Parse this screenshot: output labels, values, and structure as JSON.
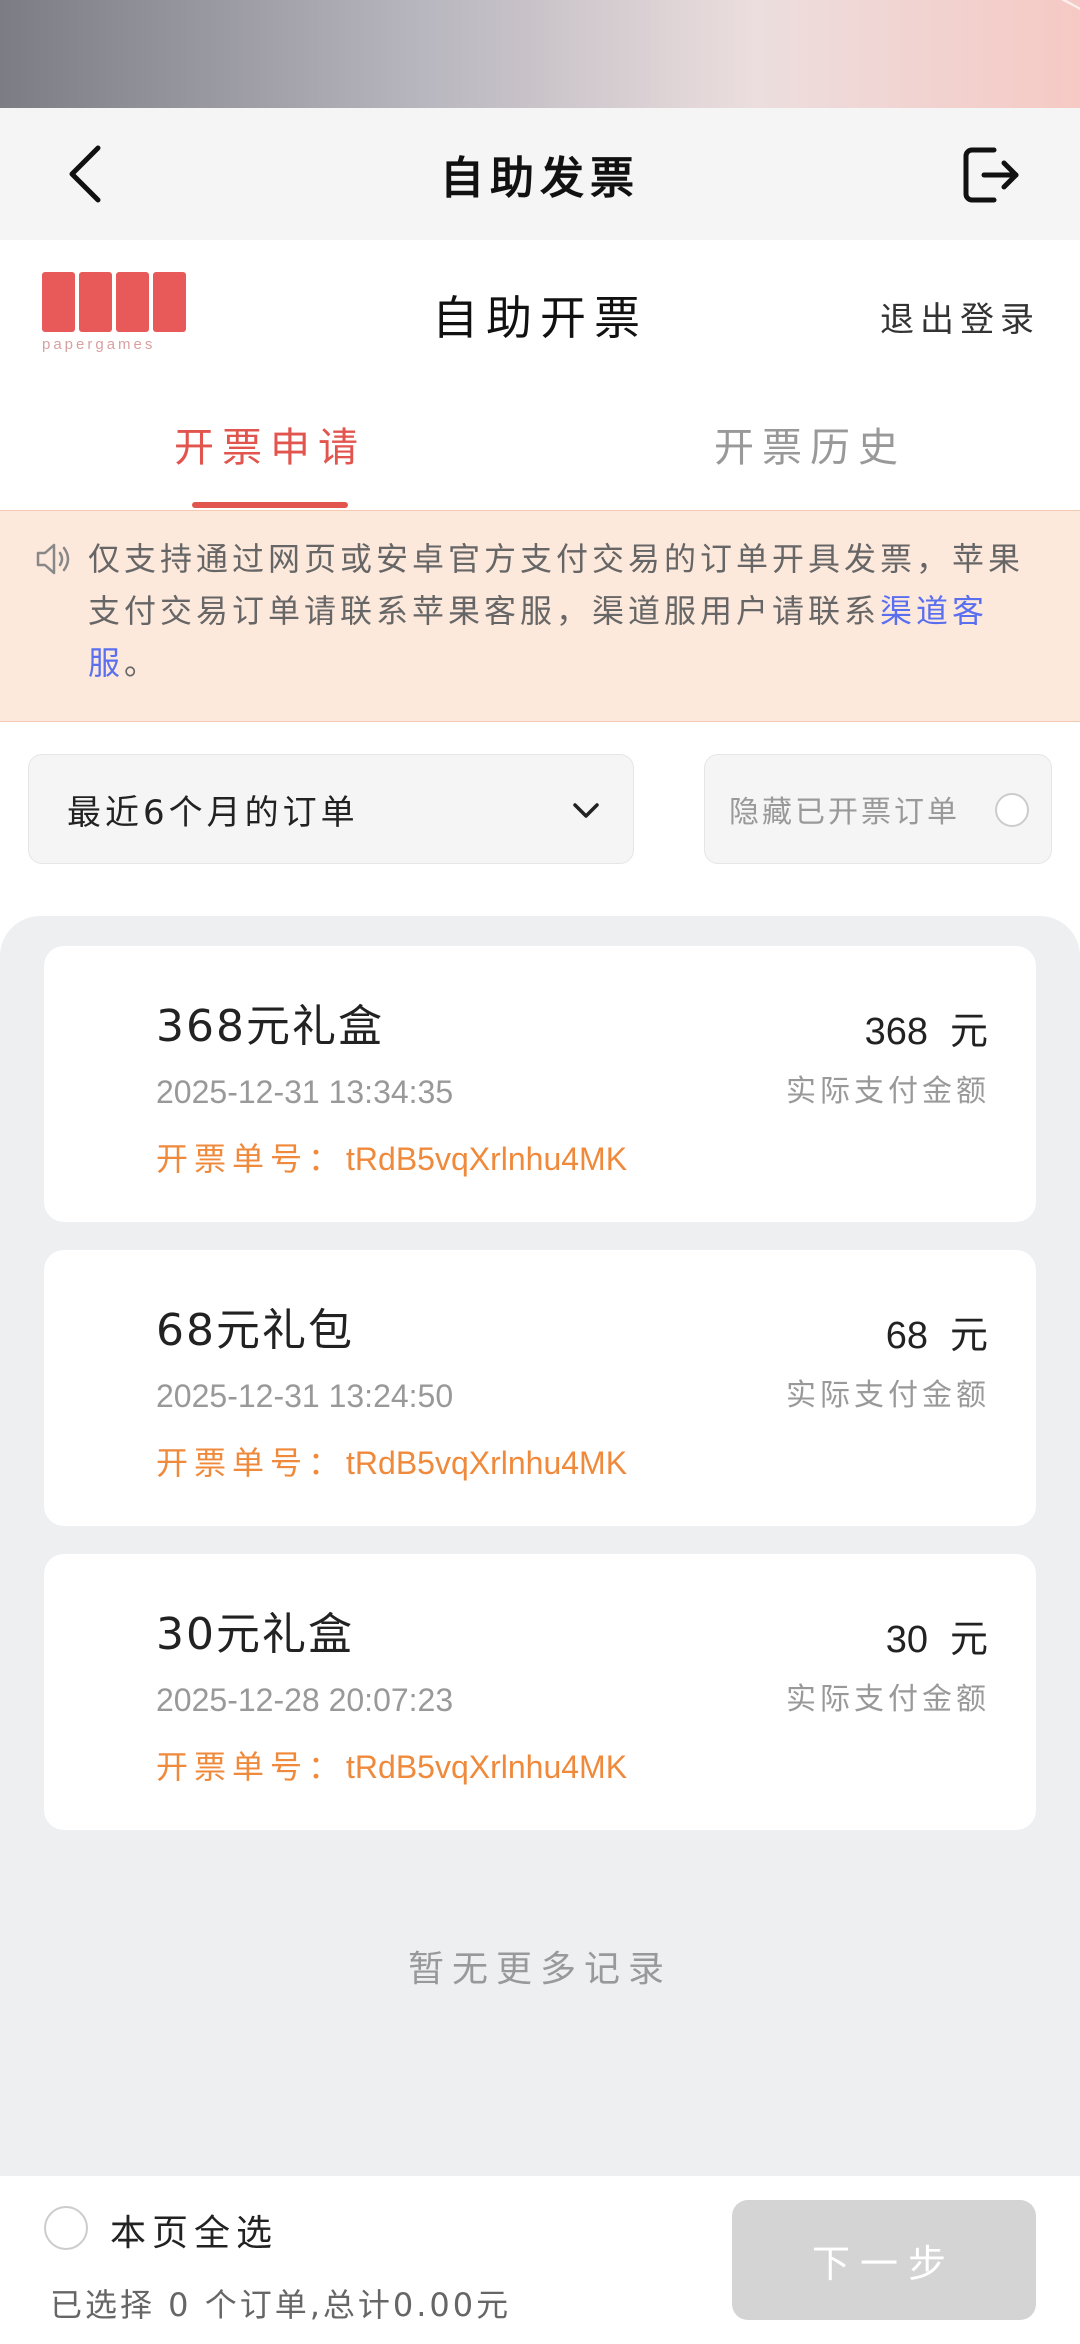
{
  "nav": {
    "title": "自助发票"
  },
  "header": {
    "brand_word": "papergames",
    "title": "自助开票",
    "logout": "退出登录"
  },
  "tabs": [
    {
      "label": "开票申请",
      "active": true
    },
    {
      "label": "开票历史",
      "active": false
    }
  ],
  "notice": {
    "text": "仅支持通过网页或安卓官方支付交易的订单开具发票，苹果支付交易订单请联系苹果客服，渠道服用户请联系",
    "link": "渠道客服",
    "tail": "。"
  },
  "filters": {
    "period": "最近6个月的订单",
    "hide_invoiced": "隐藏已开票订单"
  },
  "orders": [
    {
      "name": "368元礼盒",
      "date": "2025-12-31 13:34:35",
      "invoice_label": "开票单号：",
      "invoice_no": "tRdB5vqXrlnhu4MK",
      "amount": "368",
      "unit": "元",
      "paid_label": "实际支付金额"
    },
    {
      "name": "68元礼包",
      "date": "2025-12-31 13:24:50",
      "invoice_label": "开票单号：",
      "invoice_no": "tRdB5vqXrlnhu4MK",
      "amount": "68",
      "unit": "元",
      "paid_label": "实际支付金额"
    },
    {
      "name": "30元礼盒",
      "date": "2025-12-28 20:07:23",
      "invoice_label": "开票单号：",
      "invoice_no": "tRdB5vqXrlnhu4MK",
      "amount": "30",
      "unit": "元",
      "paid_label": "实际支付金额"
    }
  ],
  "no_more": "暂无更多记录",
  "footer": {
    "select_all": "本页全选",
    "summary": "已选择 0 个订单,总计0.00元",
    "next": "下一步"
  },
  "colors": {
    "accent": "#e2544e",
    "link": "#5a6ff0",
    "invoice_no": "#ef8a3c",
    "notice_bg": "#fde9dc"
  },
  "icons": [
    "back-arrow-icon",
    "exit-icon",
    "speaker-icon",
    "chevron-down-icon"
  ]
}
